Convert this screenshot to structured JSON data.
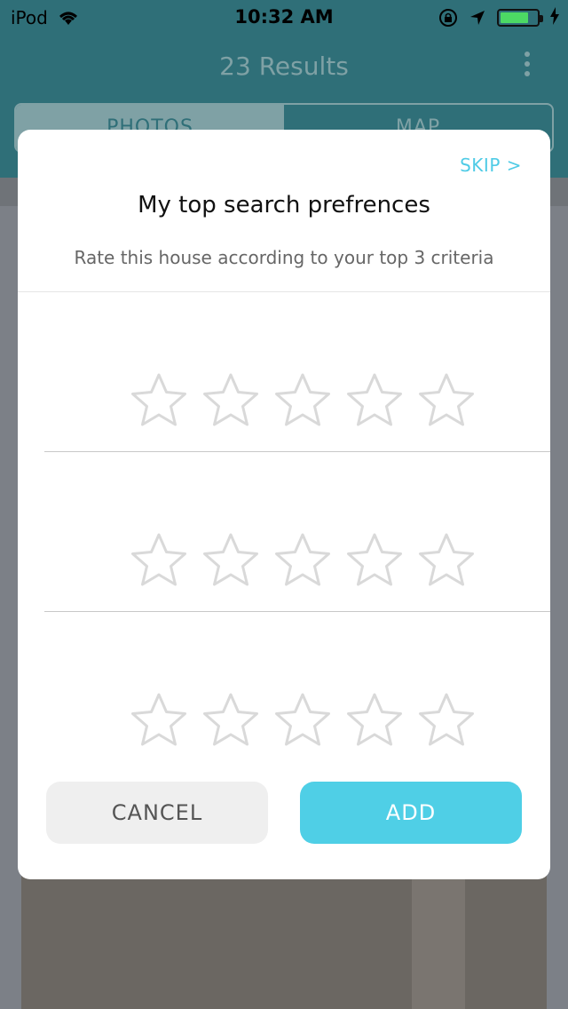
{
  "status_bar": {
    "carrier": "iPod",
    "time": "10:32 AM"
  },
  "header": {
    "title": "23 Results",
    "tabs": [
      {
        "label": "PHOTOS"
      },
      {
        "label": "MAP"
      }
    ]
  },
  "modal": {
    "skip_label": "SKIP >",
    "title": "My top search prefrences",
    "subtitle": "Rate this house according to your top 3 criteria",
    "ratings": [
      {
        "stars": 5,
        "filled": 0
      },
      {
        "stars": 5,
        "filled": 0
      },
      {
        "stars": 5,
        "filled": 0
      }
    ],
    "cancel_label": "CANCEL",
    "add_label": "ADD"
  },
  "colors": {
    "accent": "#4fcfe6",
    "header": "#2f6f78",
    "star_outline": "#d9d9d9",
    "battery": "#4cd964"
  }
}
